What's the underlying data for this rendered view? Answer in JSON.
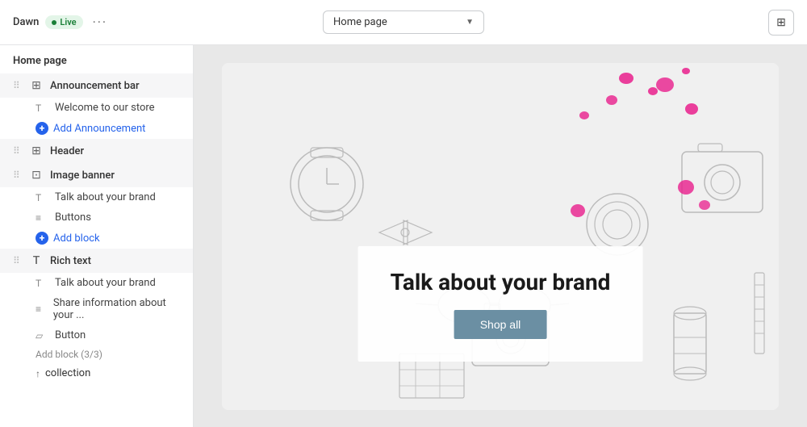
{
  "topbar": {
    "theme_name": "Dawn",
    "live_label": "Live",
    "more_icon": "···",
    "page_select": "Home page",
    "select_arrow": "▼",
    "grid_icon": "⊞"
  },
  "sidebar": {
    "title": "Home page",
    "sections": [
      {
        "name": "announcement-bar",
        "label": "Announcement bar",
        "children": [
          {
            "name": "welcome",
            "label": "Welcome to our store",
            "icon": "T"
          },
          {
            "name": "add-announcement",
            "label": "Add Announcement",
            "is_add": true
          }
        ]
      },
      {
        "name": "header",
        "label": "Header",
        "children": []
      },
      {
        "name": "image-banner",
        "label": "Image banner",
        "children": [
          {
            "name": "talk-about",
            "label": "Talk about your brand",
            "icon": "T"
          },
          {
            "name": "buttons",
            "label": "Buttons",
            "icon": "≡"
          },
          {
            "name": "add-block",
            "label": "Add block",
            "is_add": true
          }
        ]
      },
      {
        "name": "rich-text",
        "label": "Rich text",
        "children": [
          {
            "name": "talk-about-2",
            "label": "Talk about your brand",
            "icon": "T"
          },
          {
            "name": "share-info",
            "label": "Share information about your ...",
            "icon": "≡"
          },
          {
            "name": "button-rt",
            "label": "Button",
            "icon": "▱"
          },
          {
            "name": "add-block-3",
            "label": "Add block (3/3)",
            "is_add_disabled": true
          }
        ]
      }
    ],
    "collection_label": "collection"
  },
  "canvas": {
    "brand_title": "Talk about your brand",
    "shop_all_label": "Shop all"
  }
}
